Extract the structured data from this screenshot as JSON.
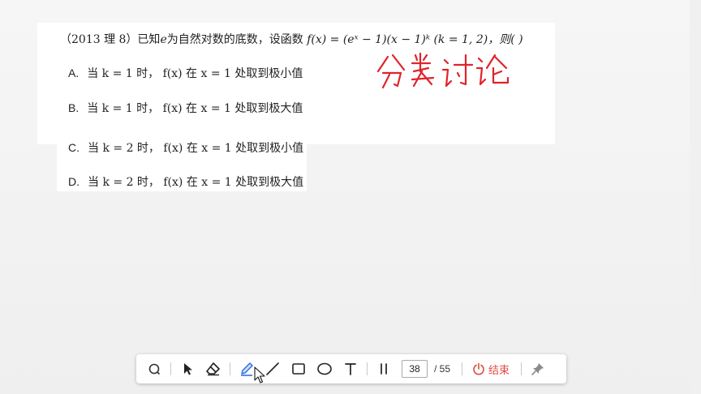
{
  "question": {
    "prefix": "（2013 理 8）已知",
    "e_var": "e",
    "mid": "为自然对数的底数，设函数",
    "formula": "f(x) = (eˣ − 1)(x − 1)ᵏ (k = 1, 2)，则(        )"
  },
  "options": [
    {
      "letter": "A.",
      "text": "当 k = 1 时， f(x) 在 x = 1 处取到极小值"
    },
    {
      "letter": "B.",
      "text": "当 k = 1 时， f(x) 在 x = 1 处取到极大值"
    },
    {
      "letter": "C.",
      "text": "当 k = 2 时， f(x) 在 x = 1 处取到极小值"
    },
    {
      "letter": "D.",
      "text": "当 k = 2 时， f(x) 在 x = 1 处取到极大值"
    }
  ],
  "annotation": {
    "text": "分类讨论",
    "color": "#e0232b"
  },
  "toolbar": {
    "tools": [
      "laser-icon",
      "pointer-icon",
      "eraser-icon",
      "pen-icon",
      "line-icon",
      "rectangle-icon",
      "ellipse-icon",
      "text-icon",
      "pause-icon"
    ],
    "current_page": "38",
    "total_pages": "/ 55",
    "end_label": "结束",
    "accent": "#e04b3f",
    "pen_color": "#2f6fe0"
  }
}
